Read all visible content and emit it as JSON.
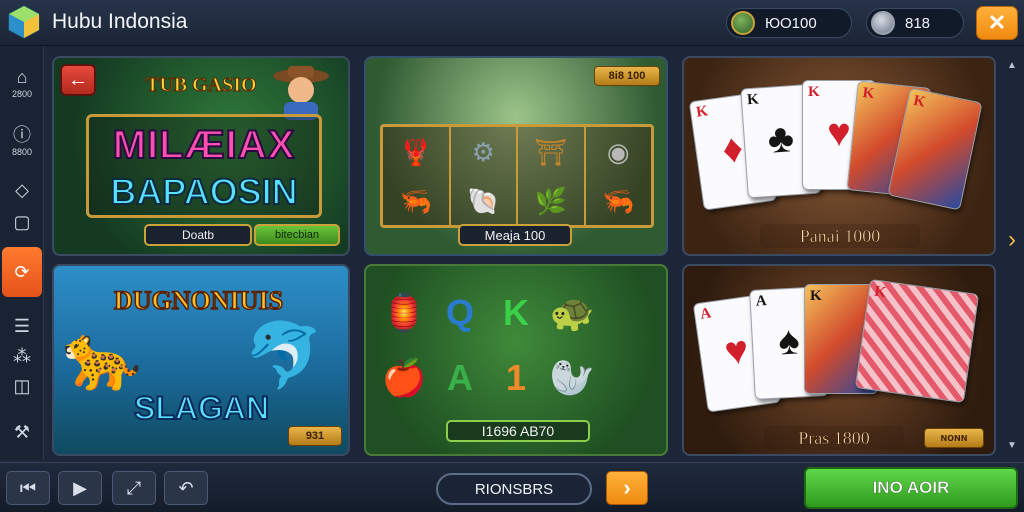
{
  "app": {
    "title": "Hubu Indonsia"
  },
  "header": {
    "balance_gold": "ЮО100",
    "balance_silver": "818",
    "close_label": "✕"
  },
  "sidebar": {
    "items": [
      {
        "icon": "⌂",
        "label": "2800",
        "name": "home-icon"
      },
      {
        "icon": "ⓘ",
        "label": "8800",
        "name": "info-icon"
      },
      {
        "icon": "◇",
        "label": "",
        "name": "diamond-icon"
      },
      {
        "icon": "▢",
        "label": "",
        "name": "square-icon"
      },
      {
        "icon": "⟳",
        "label": "",
        "name": "refresh-icon"
      },
      {
        "icon": "☰",
        "label": "",
        "name": "list-icon"
      },
      {
        "icon": "⁂",
        "label": "",
        "name": "settings-icon"
      },
      {
        "icon": "◫",
        "label": "",
        "name": "layout-icon"
      },
      {
        "icon": "⚒",
        "label": "",
        "name": "tools-icon"
      }
    ]
  },
  "tiles": {
    "t1": {
      "back": "←",
      "subtitle": "TUB GASIO",
      "line1": "MILÆIAX",
      "line2": "BAPAOSIN",
      "btn_left": "Doatb",
      "btn_right": "bitecbian"
    },
    "t2": {
      "badge": "8i8 100",
      "plate": "Meaja 100"
    },
    "t3": {
      "plate": "Panai 1000"
    },
    "t4": {
      "title": "DUGNONIUIS",
      "word": "SLAGAN",
      "badge": "931"
    },
    "t5": {
      "plate": "I1696 AB70"
    },
    "t6": {
      "plate": "Pras 1800",
      "badge": "ɴoɴɴ"
    }
  },
  "footer": {
    "browse_label": "RIONSBRS",
    "next_label": "›",
    "play_label": "INO AOIR"
  },
  "colors": {
    "accent_orange": "#f08a10",
    "accent_green": "#2f9a1e",
    "panel_bg": "#1c2638"
  }
}
